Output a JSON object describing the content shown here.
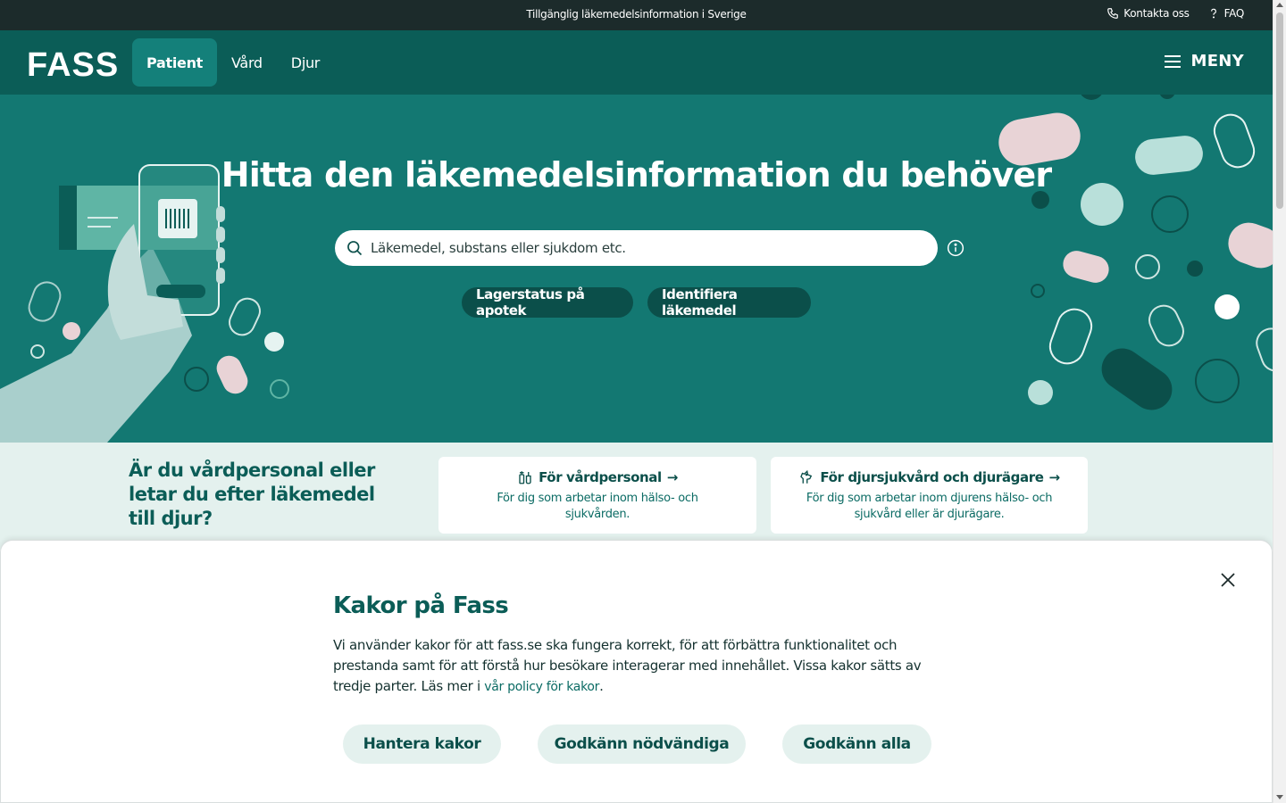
{
  "topbar": {
    "info": "Tillgänglig läkemedelsinformation i Sverige",
    "contact_label": "Kontakta oss",
    "contact_icon": "phone-icon",
    "faq_label": "FAQ",
    "faq_icon": "question-icon"
  },
  "header": {
    "logo": "FASS",
    "tabs": [
      {
        "label": "Patient",
        "active": true
      },
      {
        "label": "Vård",
        "active": false
      },
      {
        "label": "Djur",
        "active": false
      }
    ],
    "menu_label": "MENY",
    "menu_icon": "hamburger-icon"
  },
  "hero": {
    "title": "Hitta den läkemedelsinformation du behöver",
    "search_placeholder": "Läkemedel, substans eller sjukdom etc.",
    "quick_links": [
      "Lagerstatus på apotek",
      "Identifiera läkemedel"
    ]
  },
  "audience": {
    "heading": "Är du vårdpersonal eller letar du efter läkemedel till djur?",
    "cards": [
      {
        "title": "För vårdpersonal",
        "description": "För dig som arbetar inom hälso- och sjukvården.",
        "icon": "medical-tools-icon"
      },
      {
        "title": "För djursjukvård och djurägare",
        "description": "För dig som arbetar inom djurens hälso- och sjukvård eller är djurägare.",
        "icon": "animal-icon"
      }
    ]
  },
  "cookie": {
    "title": "Kakor på Fass",
    "text": "Vi använder kakor för att fass.se ska fungera korrekt, för att förbättra funktionalitet och prestanda samt för att förstå hur besökare interagerar med innehållet. Vissa kakor sätts av tredje parter. Läs mer i ",
    "policy_link": "vår policy för kakor",
    "text_end": ".",
    "buttons": [
      "Hantera kakor",
      "Godkänn nödvändiga",
      "Godkänn alla"
    ]
  },
  "colors": {
    "dark_bar": "#1c2b2b",
    "header": "#0b5d57",
    "hero": "#137872",
    "band": "#e4f1ee",
    "pink": "#e8d3d6",
    "mint": "#b9e0da"
  }
}
